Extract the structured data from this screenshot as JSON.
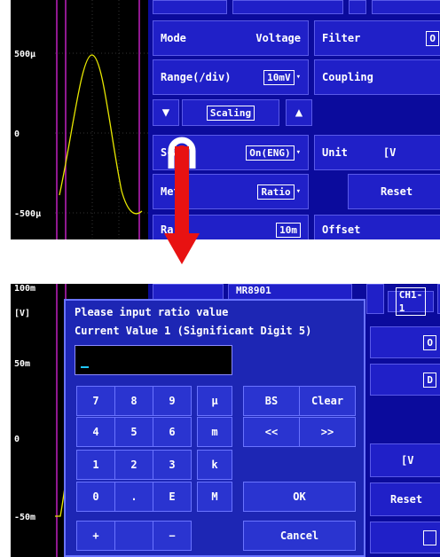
{
  "top": {
    "y_labels": [
      "500µ",
      "0",
      "-500µ"
    ],
    "rows": {
      "mode_label": "Mode",
      "mode_value": "Voltage",
      "filter_label": "Filter",
      "filter_value": "O",
      "range_label": "Range(/div)",
      "range_value": "10mV",
      "coupling_label": "Coupling",
      "scaling_label": "Scaling",
      "scaling_row_label": "Sca",
      "scaling_value": "On(ENG)",
      "unit_label": "Unit",
      "unit_value": "[V",
      "method_label": "Met",
      "method_value": "Ratio",
      "reset_label": "Reset",
      "ratio_label": "Ra",
      "ratio_value": "10m",
      "offset_label": "Offset"
    }
  },
  "bottom": {
    "y_labels": [
      "100m",
      "[V]",
      "50m",
      "0",
      "-50m"
    ],
    "header_model": "MR8901",
    "header_channel": "CH1-1",
    "behind": {
      "r1": "O",
      "r2": "D",
      "unit": "[V",
      "reset": "Reset"
    }
  },
  "dialog": {
    "title": "Please input ratio value",
    "current": "Current Value 1 (Significant Digit 5)",
    "input_value": "",
    "keys": {
      "k7": "7",
      "k8": "8",
      "k9": "9",
      "mu": "µ",
      "k4": "4",
      "k5": "5",
      "k6": "6",
      "m": "m",
      "k1": "1",
      "k2": "2",
      "k3": "3",
      "k": "k",
      "k0": "0",
      "dot": ".",
      "E": "E",
      "M": "M",
      "plus": "+",
      "minus": "−",
      "bs": "BS",
      "clear": "Clear",
      "left": "<<",
      "right": ">>",
      "ok": "OK",
      "cancel": "Cancel"
    }
  }
}
